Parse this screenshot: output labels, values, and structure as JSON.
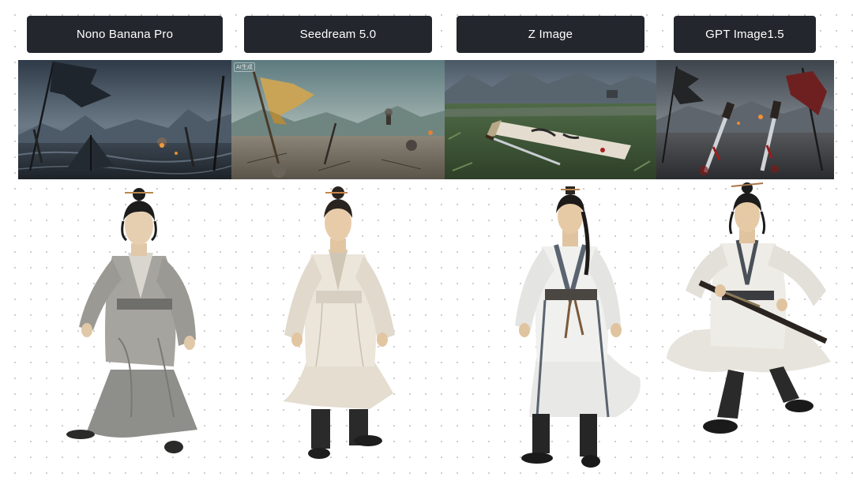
{
  "models": [
    {
      "name": "Nono Banana Pro",
      "scene_watermark": ""
    },
    {
      "name": "Seedream 5.0",
      "scene_watermark": "AI生成"
    },
    {
      "name": "Z Image",
      "scene_watermark": ""
    },
    {
      "name": "GPT Image1.5",
      "scene_watermark": ""
    }
  ],
  "colors": {
    "label_bg": "#23262d",
    "label_text": "#ffffff",
    "page_bg": "#ffffff",
    "dot_grid": "#c9c9c9"
  }
}
